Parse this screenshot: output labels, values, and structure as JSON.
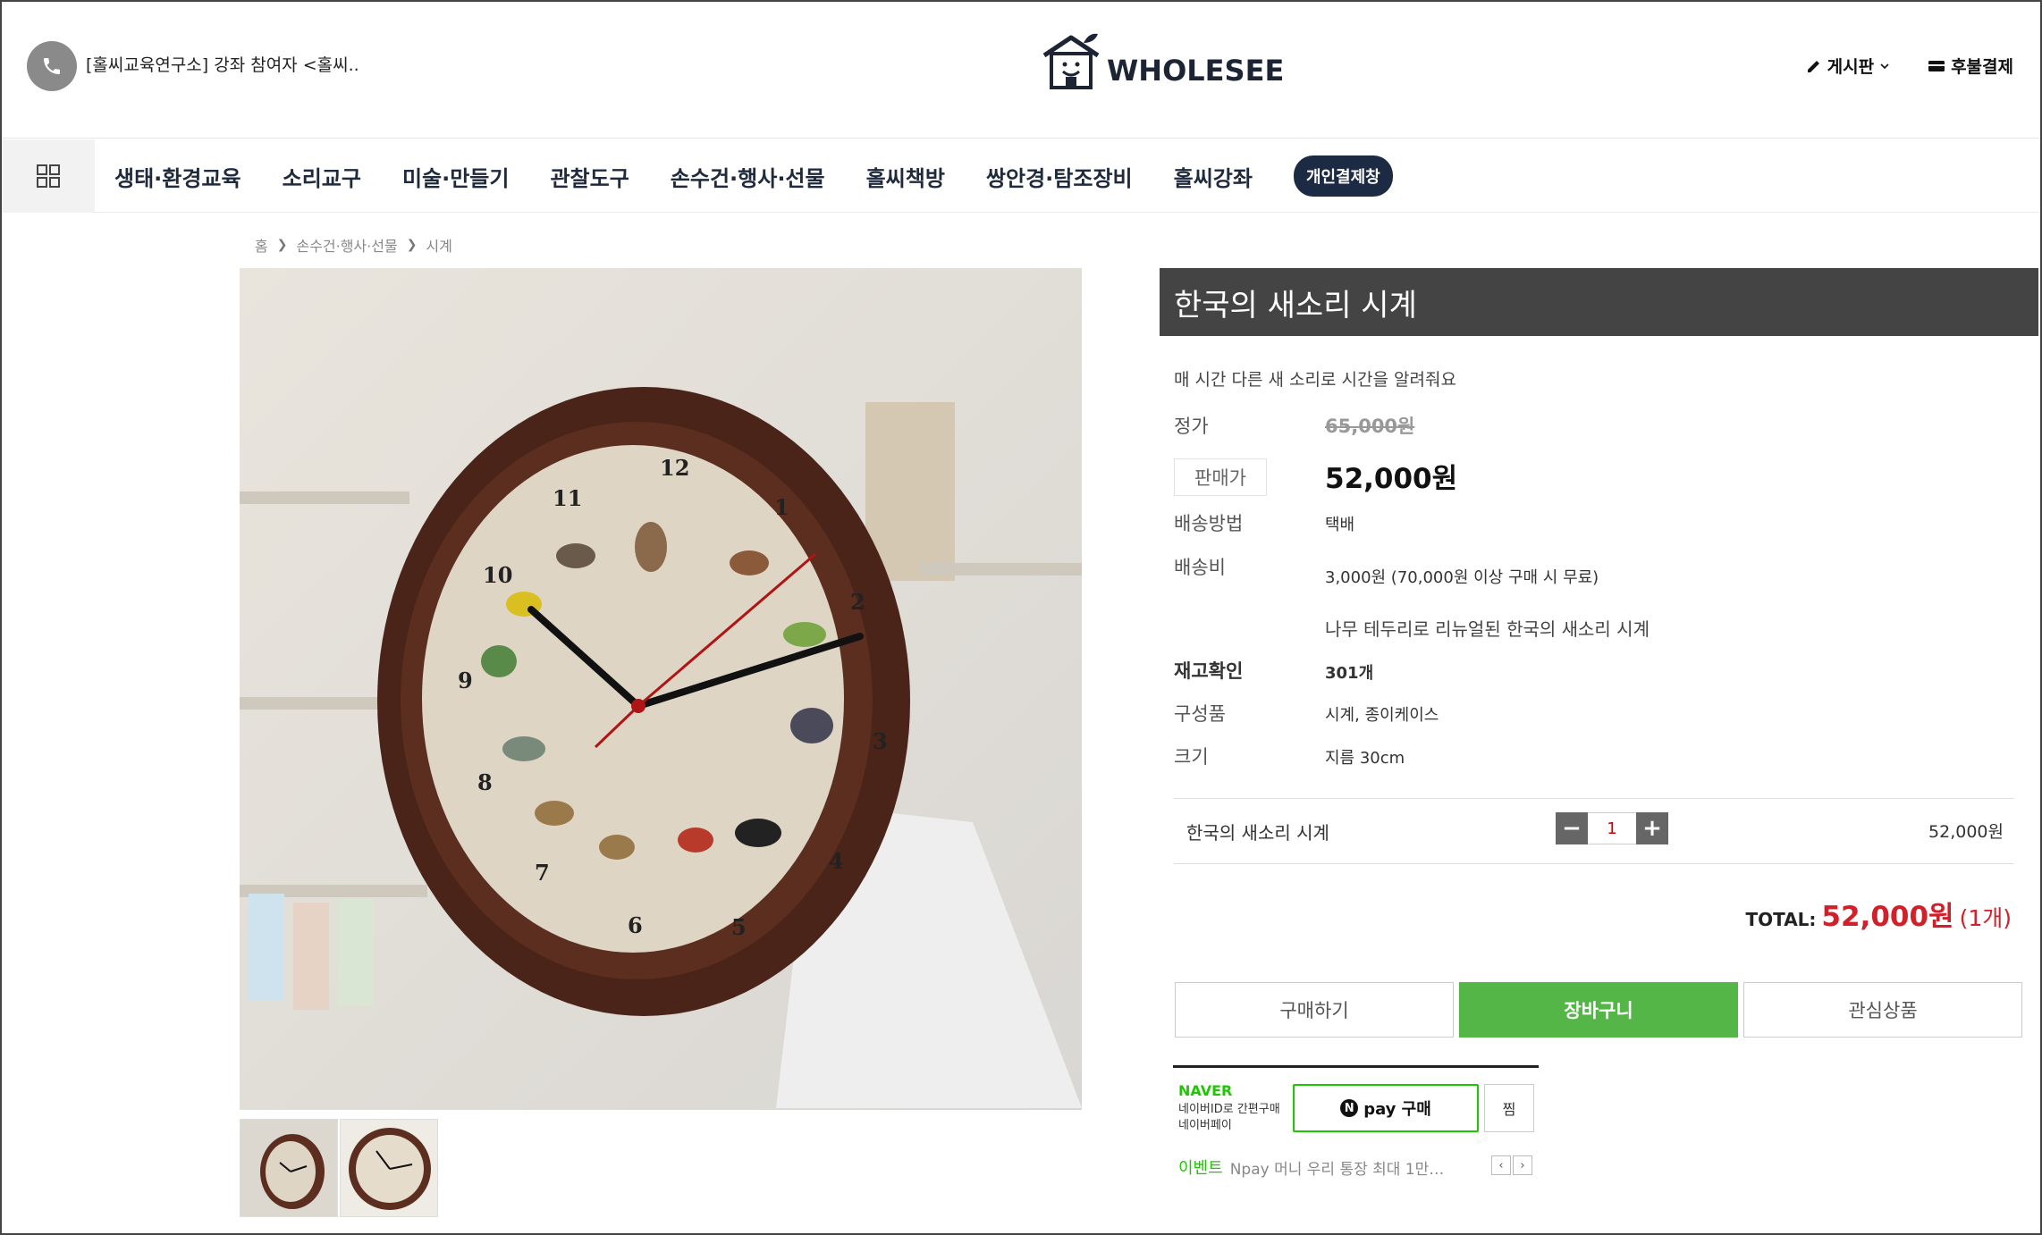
{
  "header": {
    "notice": "[홀씨교육연구소] 강좌 참여자 <홀씨..",
    "logo_text": "WHOLESEE",
    "board_label": "게시판",
    "deferred_pay_label": "후불결제"
  },
  "nav": {
    "items": [
      {
        "label": "생태·환경교육"
      },
      {
        "label": "소리교구"
      },
      {
        "label": "미술·만들기"
      },
      {
        "label": "관찰도구"
      },
      {
        "label": "손수건·행사·선물"
      },
      {
        "label": "홀씨책방"
      },
      {
        "label": "쌍안경·탐조장비"
      },
      {
        "label": "홀씨강좌"
      }
    ],
    "badge": "개인결제창"
  },
  "breadcrumb": {
    "home": "홈",
    "category": "손수건·행사·선물",
    "current": "시계"
  },
  "product": {
    "title": "한국의 새소리 시계",
    "subtitle": "매 시간 다른 새 소리로 시간을 알려줘요",
    "list_price_label": "정가",
    "list_price": "65,000원",
    "sale_price_label": "판매가",
    "sale_price": "52,000원",
    "shipping_method_label": "배송방법",
    "shipping_method": "택배",
    "shipping_fee_label": "배송비",
    "shipping_fee": "3,000원 (70,000원 이상 구매 시 무료)",
    "description": "나무 테두리로 리뉴얼된 한국의 새소리 시계",
    "stock_label": "재고확인",
    "stock": "301개",
    "components_label": "구성품",
    "components": "시계, 종이케이스",
    "size_label": "크기",
    "size": "지름 30cm"
  },
  "option": {
    "name": "한국의 새소리 시계",
    "quantity": "1",
    "price": "52,000원"
  },
  "total": {
    "label": "TOTAL:",
    "price": "52,000원",
    "count": "(1개)"
  },
  "actions": {
    "buy": "구매하기",
    "cart": "장바구니",
    "wishlist": "관심상품"
  },
  "npay": {
    "brand": "NAVER",
    "desc_line1": "네이버ID로 간편구매",
    "desc_line2": "네이버페이",
    "n_icon": "N",
    "button": "pay 구매",
    "wish": "찜",
    "event_label": "이벤트",
    "event_text": "Npay 머니 우리 통장 최대 1만…"
  },
  "colors": {
    "accent_green": "#53b646",
    "price_red": "#d1202a",
    "naver_green": "#1ec800",
    "title_bar": "#444444",
    "nav_badge": "#1c2a44"
  }
}
